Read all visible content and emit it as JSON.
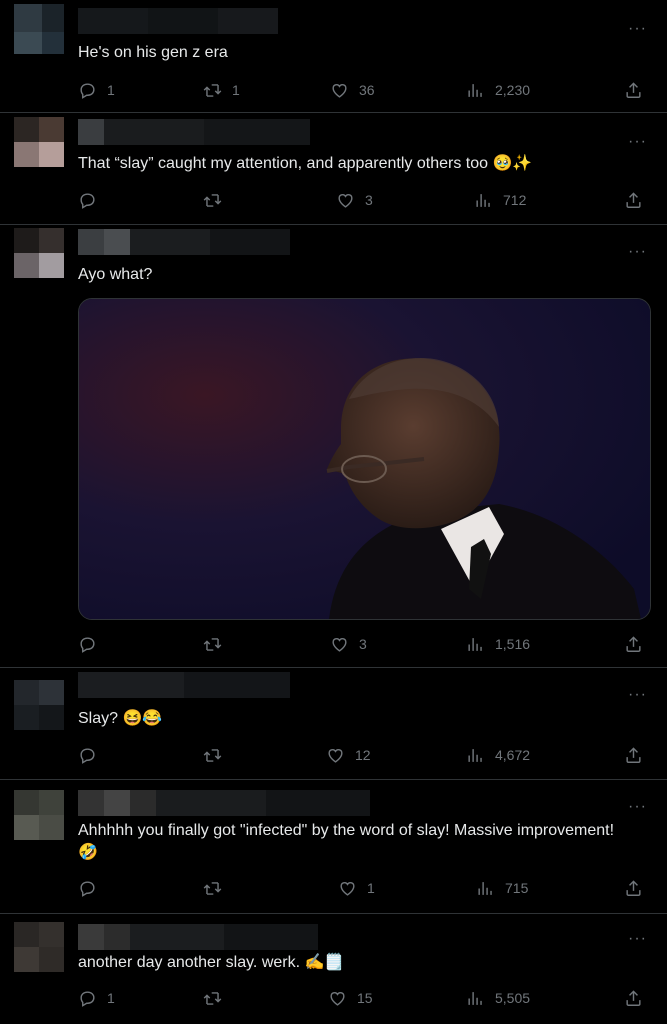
{
  "tweets": [
    {
      "text": "He's on his gen z era",
      "replies": "1",
      "retweets": "1",
      "likes": "36",
      "views": "2,230"
    },
    {
      "text": "That “slay” caught my attention, and apparently others too 🥹✨",
      "replies": "",
      "retweets": "",
      "likes": "3",
      "views": "712"
    },
    {
      "text": "Ayo what?",
      "replies": "",
      "retweets": "",
      "likes": "3",
      "views": "1,516"
    },
    {
      "text": "Slay? 😆😂",
      "replies": "",
      "retweets": "",
      "likes": "12",
      "views": "4,672"
    },
    {
      "text": "Ahhhhh you finally got \"infected\" by the word of slay! Massive improvement! 🤣",
      "replies": "",
      "retweets": "",
      "likes": "1",
      "views": "715"
    },
    {
      "text": "another day another slay. werk. ✍️🗒️",
      "replies": "1",
      "retweets": "",
      "likes": "15",
      "views": "5,505"
    }
  ],
  "more_label": "···",
  "icons": {
    "reply": "reply-icon",
    "retweet": "retweet-icon",
    "like": "heart-icon",
    "views": "views-icon",
    "share": "share-icon",
    "more": "more-icon"
  },
  "colors": {
    "background": "#000000",
    "text": "#e7e9ea",
    "muted": "#71767b",
    "divider": "#2f3336"
  }
}
